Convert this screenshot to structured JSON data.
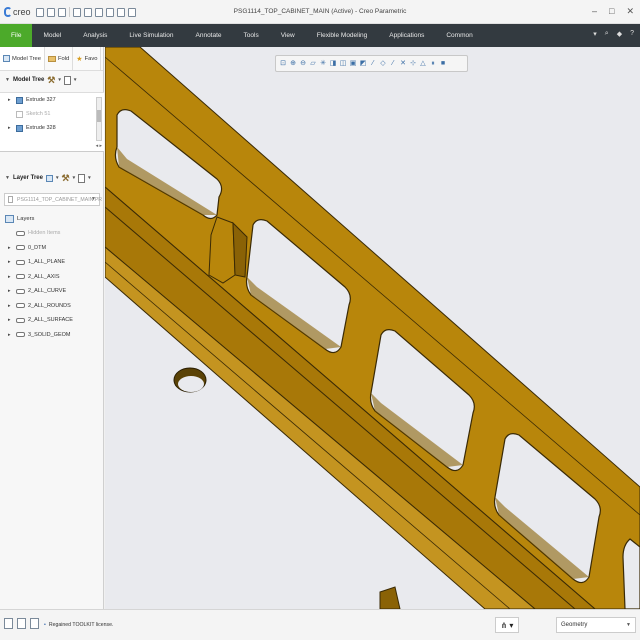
{
  "app": {
    "logo_text": "creo",
    "window_title": "PSG1114_TOP_CABINET_MAIN (Active) - Creo Parametric",
    "win_buttons": [
      "–",
      "□",
      "✕"
    ]
  },
  "ribbon": {
    "tabs": [
      "File",
      "Model",
      "Analysis",
      "Live Simulation",
      "Annotate",
      "Tools",
      "View",
      "Flexible Modeling",
      "Applications",
      "Common"
    ],
    "right_icons": [
      "▾",
      "⌕",
      "◆",
      "?"
    ]
  },
  "navigator": {
    "tabs": [
      "Model Tree",
      "Fold",
      "Favo"
    ]
  },
  "model_tree": {
    "title": "Model Tree",
    "items": [
      {
        "label": "Extrude 327",
        "dim": false
      },
      {
        "label": "Sketch 51",
        "dim": true
      },
      {
        "label": "Extrude 328",
        "dim": false
      }
    ],
    "hscroll": "◂ ▸"
  },
  "layer_tree": {
    "title": "Layer Tree",
    "model_combo": "PSG1114_TOP_CABINET_MAIN.PR",
    "root": "Layers",
    "items": [
      {
        "label": "Hidden Items",
        "dim": true
      },
      {
        "label": "0_DTM",
        "dim": false
      },
      {
        "label": "1_ALL_PLANE",
        "dim": false
      },
      {
        "label": "2_ALL_AXIS",
        "dim": false
      },
      {
        "label": "2_ALL_CURVE",
        "dim": false
      },
      {
        "label": "2_ALL_ROUNDS",
        "dim": false
      },
      {
        "label": "2_ALL_SURFACE",
        "dim": false
      },
      {
        "label": "3_SOLID_GEOM",
        "dim": false
      }
    ]
  },
  "graphics_toolbar": {
    "icons": [
      "refit",
      "zoom-in",
      "zoom-out",
      "repaint",
      "spin-center",
      "display-style",
      "view-manager",
      "saved-views",
      "datum-display",
      "annotation-display",
      "plane-display",
      "axis-display",
      "point-display",
      "csys-display",
      "pause",
      "stop",
      "appearance"
    ]
  },
  "status": {
    "message": "Regained TOOLKIT license.",
    "filter_value": "Geometry"
  },
  "colors": {
    "ribbon": "#333a40",
    "file_tab": "#4caa2a",
    "model_fill": "#b8860b",
    "model_edge": "#3a2a05",
    "viewport_bg": "#e9eaee"
  }
}
